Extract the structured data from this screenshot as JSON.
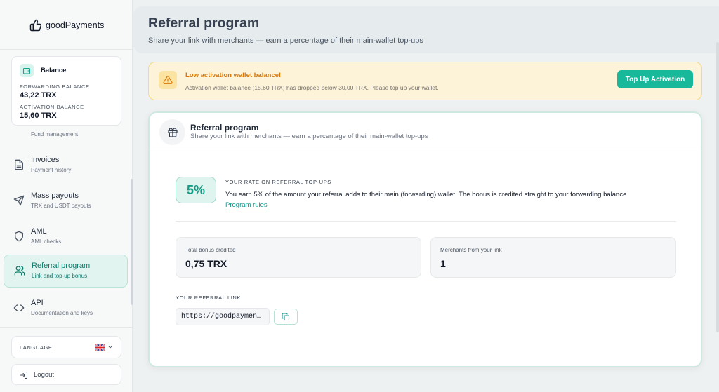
{
  "brand": {
    "name": "goodPayments"
  },
  "balance": {
    "title": "Balance",
    "forwarding_label": "FORWARDING BALANCE",
    "forwarding_value": "43,22 TRX",
    "activation_label": "ACTIVATION BALANCE",
    "activation_value": "15,60 TRX"
  },
  "sidebar": {
    "cut_item_sub": "Fund management",
    "items": [
      {
        "label": "Invoices",
        "sub": "Payment history",
        "icon": "document-icon"
      },
      {
        "label": "Mass payouts",
        "sub": "TRX and USDT payouts",
        "icon": "send-icon"
      },
      {
        "label": "AML",
        "sub": "AML checks",
        "icon": "shield-icon"
      },
      {
        "label": "Referral program",
        "sub": "Link and top-up bonus",
        "icon": "users-icon",
        "active": true
      },
      {
        "label": "API",
        "sub": "Documentation and keys",
        "icon": "code-icon"
      }
    ],
    "language_label": "LANGUAGE",
    "logout_label": "Logout"
  },
  "header": {
    "title": "Referral program",
    "subtitle": "Share your link with merchants — earn a percentage of their main-wallet top-ups"
  },
  "alert": {
    "title": "Low activation wallet balance!",
    "text": "Activation wallet balance (15,60 TRX) has dropped below 30,00 TRX. Please top up your wallet.",
    "button": "Top Up Activation"
  },
  "card": {
    "title": "Referral program",
    "subtitle": "Share your link with merchants — earn a percentage of their main-wallet top-ups",
    "rate_value": "5%",
    "rate_label": "YOUR RATE ON REFERRAL TOP-UPS",
    "rate_description": "You earn 5% of the amount your referral adds to their main (forwarding) wallet. The bonus is credited straight to your forwarding balance.",
    "rules_link": "Program rules",
    "stats": [
      {
        "label": "Total bonus credited",
        "value": "0,75 TRX"
      },
      {
        "label": "Merchants from your link",
        "value": "1"
      }
    ],
    "referral_link_label": "YOUR REFERRAL LINK",
    "referral_link_value": "https://goodpayment…"
  },
  "colors": {
    "accent": "#18b89a",
    "warning": "#d97706",
    "warning_bg": "#fdf3d9"
  }
}
